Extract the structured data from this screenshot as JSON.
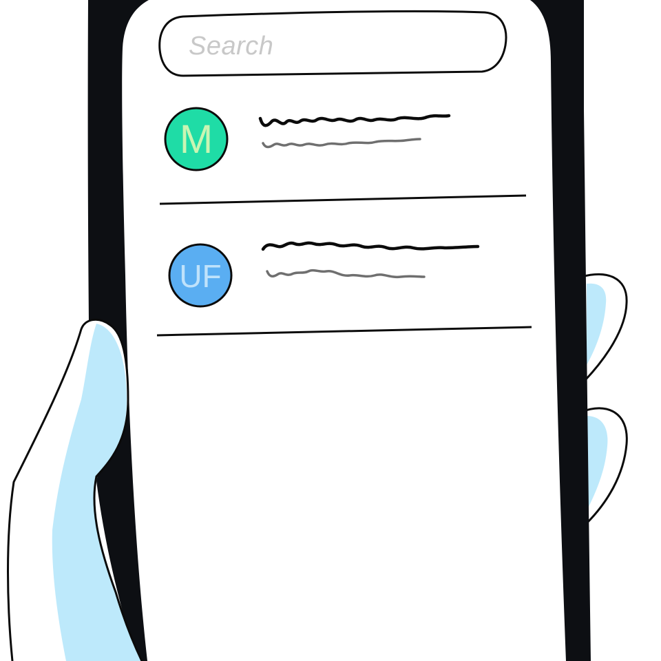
{
  "search": {
    "placeholder": "Search"
  },
  "contacts": [
    {
      "initials": "M",
      "avatar_color": "#1fdca6",
      "initials_color": "#c9f5b3",
      "name_shown_as": "squiggle",
      "subtitle_shown_as": "squiggle"
    },
    {
      "initials": "UF",
      "avatar_color": "#5aaef2",
      "initials_color": "#bfe2fb",
      "name_shown_as": "squiggle",
      "subtitle_shown_as": "squiggle"
    }
  ],
  "colors": {
    "phone_frame": "#0d0f13",
    "screen": "#ffffff",
    "hand_fill": "#ffffff",
    "hand_shadow": "#bde9fb",
    "outline": "#0b0b0b",
    "primary_squiggle": "#0b0b0b",
    "secondary_squiggle": "#6f6f6f"
  }
}
